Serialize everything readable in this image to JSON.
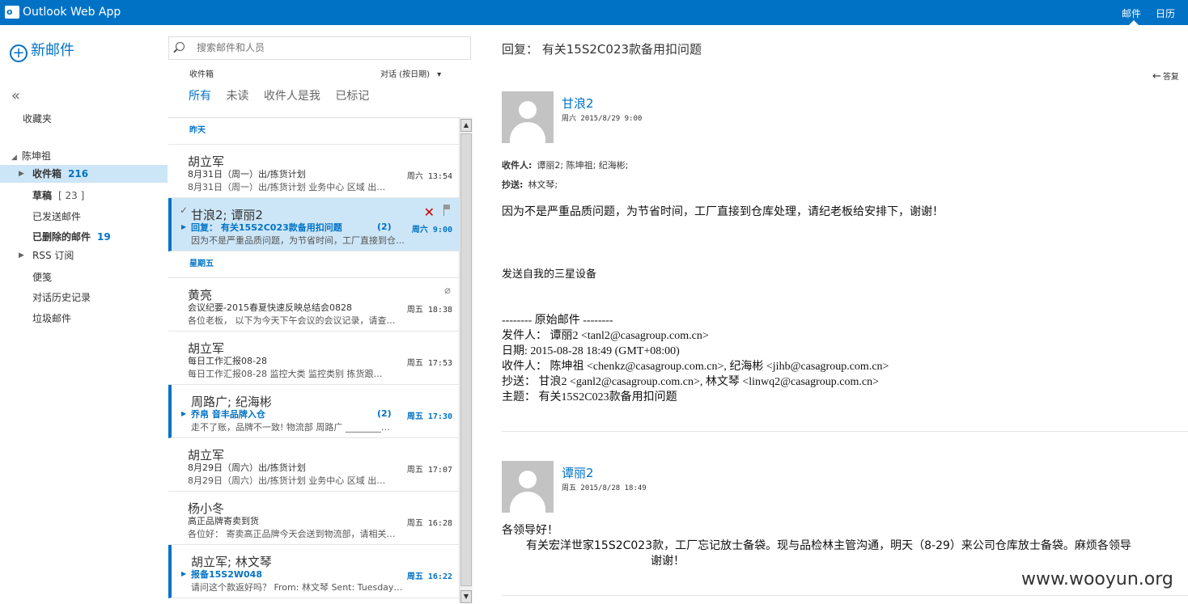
{
  "app": {
    "title": "Outlook Web App",
    "logo_letter": "o"
  },
  "topnav": {
    "mail": "邮件",
    "calendar": "日历"
  },
  "folders_pane": {
    "new_mail": "新邮件",
    "collapse": "«",
    "favorites": "收藏夹",
    "account": "陈坤祖",
    "items": [
      {
        "label": "收件箱",
        "count": "216"
      },
      {
        "label": "草稿",
        "count": "[ 23 ]"
      },
      {
        "label": "已发送邮件",
        "count": ""
      },
      {
        "label": "已删除的邮件",
        "count": "19"
      },
      {
        "label": "RSS 订阅",
        "count": ""
      },
      {
        "label": "便笺",
        "count": ""
      },
      {
        "label": "对话历史记录",
        "count": ""
      },
      {
        "label": "垃圾邮件",
        "count": ""
      }
    ]
  },
  "list_pane": {
    "search_placeholder": "搜索邮件和人员",
    "folder_label": "收件箱",
    "sort_label": "对话 (按日期)",
    "filters": [
      "所有",
      "未读",
      "收件人是我",
      "已标记"
    ],
    "groups": [
      "昨天",
      "星期五"
    ],
    "messages": [
      {
        "sender": "胡立军",
        "subject": "8月31日（周一）出/拣货计划",
        "time": "周六 13:54",
        "preview": "8月31日（周一）出/拣货计划   业务中心   区域   出…"
      },
      {
        "sender": "甘浪2;  谭丽2",
        "subject": "回复： 有关15S2C023款备用扣问题",
        "count": "(2)",
        "time": "周六 9:00",
        "preview": "因为不是严重品质问题，为节省时间，工厂直接到仓…"
      },
      {
        "sender": "黄亮",
        "subject": "会议纪要-2015春夏快速反映总结会0828",
        "time": "周五 18:38",
        "preview": "各位老板，  以下为今天下午会议的会议记录，请查…"
      },
      {
        "sender": "胡立军",
        "subject": "每日工作汇报08-28",
        "time": "周五 17:53",
        "preview": "每日工作汇报08-28   监控大类   监控类别   拣货跟…"
      },
      {
        "sender": "周路广;  纪海彬",
        "subject": "乔帛 音丰品牌入仓",
        "count": "(2)",
        "time": "周五 17:30",
        "preview": "走不了账，品牌不一致!    物流部 周路广 ________…"
      },
      {
        "sender": "胡立军",
        "subject": "8月29日（周六）出/拣货计划",
        "time": "周五 17:07",
        "preview": "8月29日（周六）出/拣货计划   业务中心   区域   出…"
      },
      {
        "sender": "杨小冬",
        "subject": "高正品牌寄卖到货",
        "time": "周五 16:28",
        "preview": "各位好：  寄卖高正品牌今天会送到物流部，请相关…"
      },
      {
        "sender": "胡立军;  林文琴",
        "subject": "报备15S2W048",
        "time": "周五 16:22",
        "preview": "请问这个款返好吗？   From: 林文琴 Sent: Tuesday…"
      }
    ]
  },
  "reading_pane": {
    "title": "回复：  有关15S2C023款备用扣问题",
    "reply_all": "答复",
    "msg1": {
      "from": "甘浪2",
      "date": "周六 2015/8/29 9:00",
      "to_label": "收件人:",
      "to": "谭丽2;  陈坤祖;  纪海彬;",
      "cc_label": "抄送:",
      "cc": "林文琴;",
      "body": "因为不是严重品质问题，为节省时间，工厂直接到仓库处理，请纪老板给安排下，谢谢！",
      "signature": "发送自我的三星设备",
      "orig_header": "-------- 原始邮件 --------",
      "orig_from": "发件人：  谭丽2 <tanl2@casagroup.com.cn>",
      "orig_date": "日期: 2015-08-28 18:49 (GMT+08:00)",
      "orig_to": "收件人：  陈坤祖 <chenkz@casagroup.com.cn>, 纪海彬 <jihb@casagroup.com.cn>",
      "orig_cc": "抄送：  甘浪2 <ganl2@casagroup.com.cn>, 林文琴 <linwq2@casagroup.com.cn>",
      "orig_subject": "主题：  有关15S2C023款备用扣问题"
    },
    "msg2": {
      "from": "谭丽2",
      "date": "周五 2015/8/28 18:49",
      "greeting": "各领导好！",
      "line1": "有关宏洋世家15S2C023款，工厂忘记放士备袋。现与品检林主管沟通，明天（8-29）来公司仓库放士备袋。麻烦各领导",
      "line2": "谢谢！"
    }
  },
  "watermark": "www.wooyun.org"
}
